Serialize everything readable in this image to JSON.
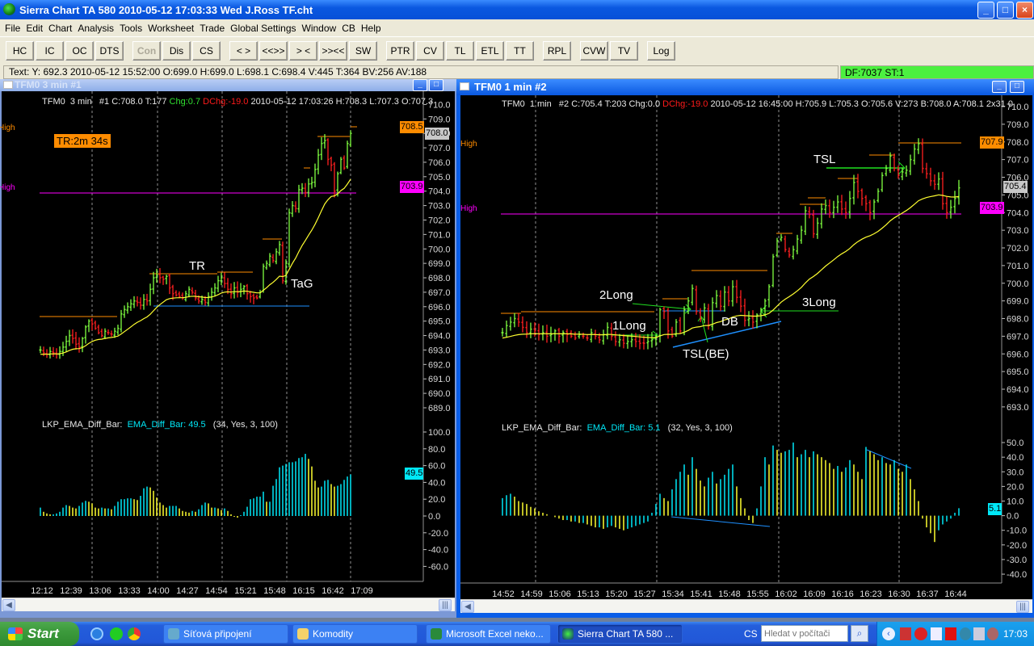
{
  "window": {
    "title": "Sierra Chart TA 580  2010-05-12  17:03:33  Wed   J.Ross TF.cht",
    "min": "_",
    "max": "□",
    "close": "×"
  },
  "menu": [
    "File",
    "Edit",
    "Chart",
    "Analysis",
    "Tools",
    "Worksheet",
    "Trade",
    "Global Settings",
    "Window",
    "CB",
    "Help"
  ],
  "toolbar": [
    [
      "HC",
      "IC",
      "OC",
      "DTS"
    ],
    [
      "Con",
      "Dis",
      "CS"
    ],
    [
      "< >",
      "<<>>",
      "> <",
      ">><<",
      "SW"
    ],
    [
      "PTR",
      "CV",
      "TL",
      "ETL",
      "TT"
    ],
    [
      "RPL"
    ],
    [
      "CVW",
      "TV"
    ],
    [
      "Log"
    ]
  ],
  "toolbar_disabled": [
    "Con"
  ],
  "status": {
    "text": "Text: Y: 692.3  2010-05-12  15:52:00  O:699.0  H:699.0  L:698.1  C:698.4  V:445  T:364  BV:256  AV:188",
    "feed": "DF:7037  ST:1"
  },
  "colors": {
    "up": "#80ff40",
    "down": "#ff2020",
    "ema": "#ffff30",
    "osc_up": "#00e8f8",
    "osc_down": "#ffff30",
    "high_orange": "#ff8c00",
    "high_magenta": "#ff00ff",
    "support": "#1e90ff"
  },
  "left": {
    "title": "TFM0  3 min   #1",
    "header": {
      "a": "TFM0  3 min   #1 C:708.0 T:177 ",
      "chg": "Chg:0.7",
      "dchg": " DChg:-19.0",
      "b": " 2010-05-12 17:03:26 H:708.3 L:707.3 O:707.3"
    },
    "timer": "TR:2m 34s",
    "high1": "High",
    "high2": "High",
    "labels": {
      "orange": "708.5",
      "current": "708.0",
      "magenta": "703.9",
      "osc": "49.5"
    },
    "annotations": {
      "tr": "TR",
      "tag": "TaG"
    },
    "indicator": {
      "name": "LKP_EMA_Diff_Bar:",
      "value": "EMA_Diff_Bar: 49.5",
      "params": "(34, Yes, 3, 100)"
    }
  },
  "right": {
    "title": "TFM0  1 min   #2",
    "header": {
      "a": "TFM0  1 min   #2 C:705.4 T:203 Chg:0.0 ",
      "dchg": "DChg:-19.0",
      "b": " 2010-05-12 16:45:00 H:705.9 L:705.3 O:705.6 V:273 B:708.0 A:708.1 2x31 0"
    },
    "high1": "High",
    "high2": "High",
    "labels": {
      "orange": "707.9",
      "current": "705.4",
      "magenta": "703.9",
      "osc": "5.1"
    },
    "annotations": {
      "l1": "1Long",
      "l2": "2Long",
      "l3": "3Long",
      "db": "DB",
      "tslbe": "TSL(BE)",
      "tsl": "TSL"
    },
    "indicator": {
      "name": "LKP_EMA_Diff_Bar:",
      "value": "EMA_Diff_Bar: 5.1",
      "params": "(32, Yes, 3, 100)"
    }
  },
  "chart_data": [
    {
      "type": "ohlc",
      "title": "TFM0 3 min #1",
      "ylim": [
        689,
        710
      ],
      "ytick_step": 1,
      "level_magenta": 703.9,
      "ema_period": 20,
      "xticks": [
        "12:12",
        "12:39",
        "13:06",
        "13:33",
        "14:00",
        "14:27",
        "14:54",
        "15:21",
        "15:48",
        "16:15",
        "16:42",
        "17:09"
      ],
      "close": [
        693.0,
        692.8,
        692.7,
        692.9,
        692.8,
        692.7,
        692.9,
        693.2,
        693.6,
        694.0,
        693.8,
        693.4,
        693.2,
        693.8,
        694.6,
        695.0,
        694.8,
        694.5,
        694.2,
        694.0,
        694.3,
        694.2,
        694.1,
        694.3,
        694.5,
        695.5,
        695.8,
        696.0,
        696.2,
        696.4,
        696.3,
        696.1,
        696.5,
        696.4,
        697.2,
        698.0,
        698.2,
        698.0,
        697.9,
        698.1,
        697.3,
        696.9,
        696.8,
        696.7,
        696.6,
        696.9,
        697.2,
        697.0,
        696.6,
        696.4,
        696.5,
        696.3,
        696.7,
        697.0,
        697.3,
        697.8,
        698.0,
        697.6,
        697.2,
        696.9,
        697.3,
        697.0,
        697.2,
        697.4,
        696.9,
        696.7,
        696.6,
        696.6,
        697.0,
        698.8,
        699.0,
        699.5,
        699.2,
        699.8,
        700.3,
        697.8,
        699.0,
        702.5,
        703.0,
        702.8,
        704.1,
        704.2,
        703.9,
        704.5,
        704.6,
        705.5,
        706.5,
        707.3,
        707.5,
        706.2,
        705.8,
        704.0,
        705.2,
        706.2,
        705.6,
        707.3,
        708.0
      ]
    },
    {
      "type": "bar",
      "title": "LKP_EMA_Diff_Bar (34, Yes, 3, 100)",
      "ylim": [
        -60,
        100
      ],
      "ytick_step": 20,
      "values": [
        10,
        5,
        3,
        2,
        2,
        3,
        5,
        10,
        13,
        12,
        10,
        9,
        12,
        16,
        18,
        17,
        15,
        10,
        9,
        10,
        9,
        9,
        8,
        12,
        17,
        20,
        20,
        21,
        21,
        20,
        19,
        24,
        33,
        35,
        34,
        30,
        22,
        16,
        13,
        10,
        12,
        12,
        12,
        9,
        6,
        5,
        4,
        6,
        5,
        8,
        13,
        16,
        15,
        10,
        10,
        9,
        7,
        9,
        6,
        2,
        -1,
        -2,
        1,
        5,
        11,
        20,
        21,
        23,
        23,
        29,
        17,
        17,
        36,
        44,
        58,
        60,
        62,
        64,
        64,
        65,
        69,
        70,
        74,
        68,
        59,
        42,
        34,
        35,
        42,
        43,
        38,
        35,
        36,
        38,
        43,
        47,
        49.5
      ]
    },
    {
      "type": "ohlc",
      "title": "TFM0 1 min #2",
      "ylim": [
        693,
        710
      ],
      "ytick_step": 1,
      "level_magenta": 703.9,
      "ema_period": 34,
      "xticks": [
        "14:52",
        "14:59",
        "15:06",
        "15:13",
        "15:20",
        "15:27",
        "15:34",
        "15:41",
        "15:48",
        "15:55",
        "16:02",
        "16:09",
        "16:16",
        "16:23",
        "16:30",
        "16:37",
        "16:44"
      ],
      "close": [
        697.2,
        697.6,
        697.8,
        698.0,
        697.8,
        697.5,
        697.2,
        697.4,
        697.3,
        697.1,
        697.2,
        697.0,
        697.1,
        697.3,
        697.0,
        697.2,
        697.1,
        697.0,
        696.9,
        697.1,
        697.0,
        696.9,
        697.2,
        697.0,
        696.8,
        697.1,
        697.5,
        697.0,
        696.7,
        696.8,
        696.6,
        696.7,
        696.8,
        696.7,
        696.6,
        696.6,
        696.7,
        696.8,
        697.0,
        698.5,
        698.4,
        697.3,
        697.0,
        697.8,
        697.3,
        698.5,
        699.0,
        699.7,
        698.4,
        698.0,
        698.6,
        697.6,
        698.9,
        699.3,
        698.7,
        699.5,
        699.0,
        699.8,
        699.2,
        698.7,
        697.9,
        698.0,
        697.8,
        698.2,
        698.5,
        699.0,
        699.8,
        701.5,
        702.4,
        702.6,
        701.9,
        701.6,
        701.9,
        702.5,
        703.0,
        704.1,
        703.9,
        702.8,
        703.4,
        704.2,
        704.4,
        704.0,
        704.3,
        704.6,
        704.2,
        704.0,
        704.8,
        705.7,
        705.2,
        704.8,
        704.5,
        704.0,
        704.6,
        705.2,
        706.1,
        706.5,
        707.2,
        706.5,
        706.1,
        706.3,
        706.4,
        707.0,
        707.6,
        707.9,
        706.5,
        706.2,
        705.8,
        705.6,
        705.9,
        704.5,
        704.0,
        704.3,
        704.8,
        705.4
      ]
    },
    {
      "type": "bar",
      "title": "LKP_EMA_Diff_Bar (32, Yes, 3, 100)",
      "ylim": [
        -40,
        50
      ],
      "ytick_step": 10,
      "values": [
        12,
        14,
        15,
        13,
        10,
        9,
        8,
        6,
        5,
        3,
        2,
        1,
        0,
        -1,
        -2,
        -3,
        -3,
        -4,
        -4,
        -5,
        -5,
        -6,
        -7,
        -8,
        -8,
        -9,
        -8,
        -7,
        -8,
        -9,
        -10,
        -9,
        -8,
        -7,
        -6,
        -5,
        -4,
        2,
        8,
        15,
        12,
        10,
        18,
        25,
        30,
        35,
        28,
        40,
        32,
        24,
        20,
        26,
        30,
        22,
        25,
        28,
        32,
        35,
        20,
        12,
        5,
        -3,
        -5,
        5,
        20,
        40,
        35,
        48,
        45,
        43,
        44,
        45,
        50,
        40,
        42,
        45,
        40,
        44,
        42,
        40,
        38,
        36,
        32,
        34,
        30,
        33,
        38,
        35,
        30,
        25,
        47,
        44,
        42,
        38,
        40,
        36,
        35,
        38,
        32,
        30,
        35,
        25,
        18,
        10,
        -2,
        -8,
        -12,
        -18,
        -10,
        -6,
        -4,
        -2,
        2,
        5.1
      ]
    }
  ],
  "taskbar": {
    "start": "Start",
    "tasks": [
      "Síťová připojení",
      "Komodity",
      "Microsoft Excel neko...",
      "Sierra Chart TA 580  ..."
    ],
    "lang": "CS",
    "search_placeholder": "Hledat v počítači",
    "clock": "17:03"
  }
}
